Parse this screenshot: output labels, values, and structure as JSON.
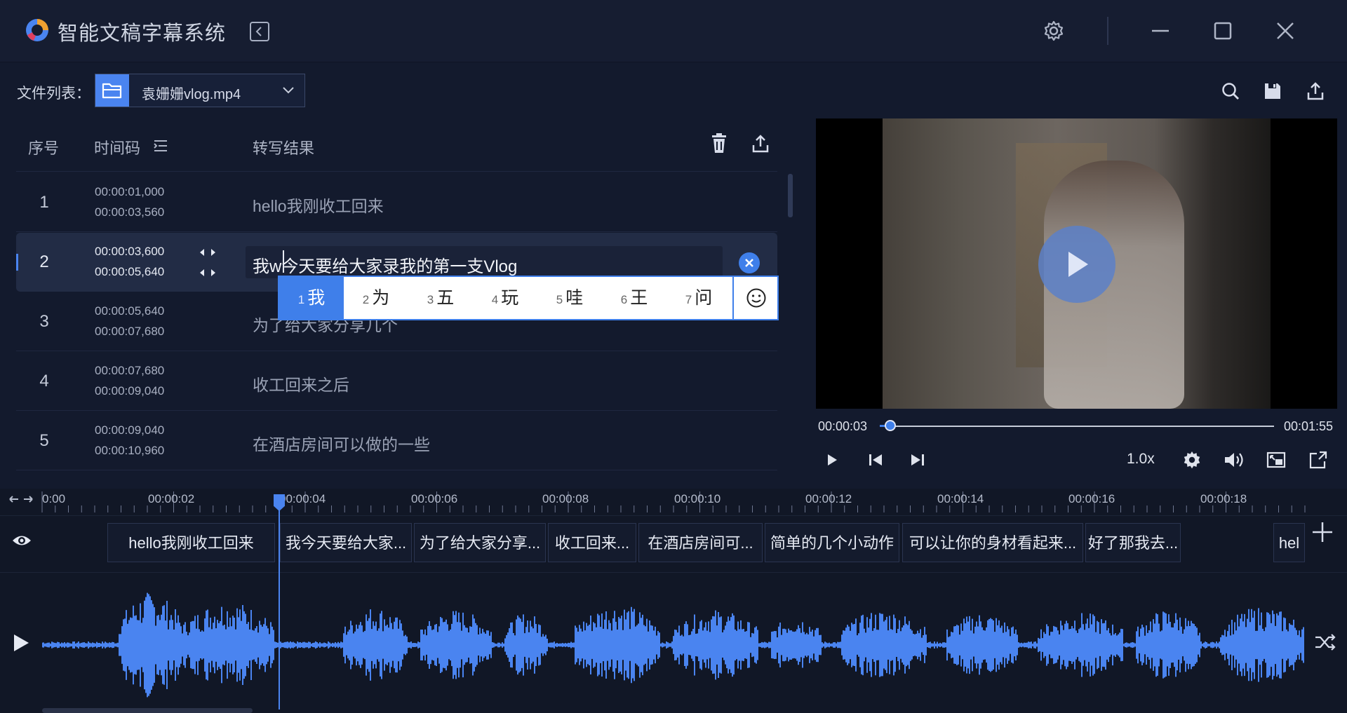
{
  "app": {
    "title": "智能文稿字幕系统"
  },
  "file_bar": {
    "label": "文件列表：",
    "file_name": "袁姗姗vlog.mp4"
  },
  "table": {
    "headers": {
      "index": "序号",
      "timecode": "时间码",
      "result": "转写结果"
    },
    "rows": [
      {
        "num": "1",
        "start": "00:00:01,000",
        "end": "00:00:03,560",
        "text": "hello我刚收工回来"
      },
      {
        "num": "2",
        "start": "00:00:03,600",
        "end": "00:00:05,640",
        "text": "我w今天要给大家录我的第一支Vlog"
      },
      {
        "num": "3",
        "start": "00:00:05,640",
        "end": "00:00:07,680",
        "text": "为了给大家分享几个"
      },
      {
        "num": "4",
        "start": "00:00:07,680",
        "end": "00:00:09,040",
        "text": "收工回来之后"
      },
      {
        "num": "5",
        "start": "00:00:09,040",
        "end": "00:00:10,960",
        "text": "在酒店房间可以做的一些"
      }
    ]
  },
  "ime": {
    "candidates": [
      {
        "n": "1",
        "c": "我"
      },
      {
        "n": "2",
        "c": "为"
      },
      {
        "n": "3",
        "c": "五"
      },
      {
        "n": "4",
        "c": "玩"
      },
      {
        "n": "5",
        "c": "哇"
      },
      {
        "n": "6",
        "c": "王"
      },
      {
        "n": "7",
        "c": "问"
      }
    ]
  },
  "player": {
    "current_time": "00:00:03",
    "total_time": "00:01:55",
    "speed": "1.0x",
    "progress_fraction": 0.026
  },
  "timeline": {
    "ticks": [
      "0:00",
      "00:00:02",
      "00:00:04",
      "00:00:06",
      "00:00:08",
      "00:00:10",
      "00:00:12",
      "00:00:14",
      "00:00:16",
      "00:00:18"
    ],
    "segments": [
      "hello我刚收工回来",
      "我今天要给大家...",
      "为了给大家分享...",
      "收工回来...",
      "在酒店房间可...",
      "简单的几个小动作",
      "可以让你的身材看起来...",
      "好了那我去...",
      "hel"
    ]
  },
  "colors": {
    "accent": "#3f7fea",
    "background": "#131a2d",
    "waveform": "#4a84f0"
  }
}
